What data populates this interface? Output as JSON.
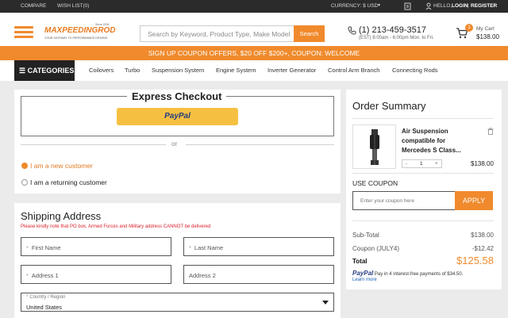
{
  "topbar": {
    "compare": "COMPARE",
    "wishlist": "WISH LIST(0)",
    "currency": "CURRENCY: $ USD",
    "hello": "HELLO,",
    "login": "LOGIN",
    "separator": "|",
    "register": "REGISTER"
  },
  "header": {
    "logo_text": "MAXPEEDINGRODS",
    "logo_since": "Since 2006",
    "logo_tagline": "YOUR GATEWAY TO PERFORMANCE DRIVING",
    "search_placeholder": "Search by Keyword, Product Type, Make Model Year",
    "search_button": "Search",
    "phone": "(1) 213-459-3517",
    "phone_hours": "(EST) 8:00am - 6:00pm Mon. to Fri.",
    "cart_count": "1",
    "cart_label": "My Cart",
    "cart_total": "$138.00"
  },
  "promo": "SIGN UP COUPON OFFERS, $20 OFF $200+, COUPON: WELCOME",
  "nav": {
    "categories": "CATEGORIES",
    "items": [
      "Coilovers",
      "Turbo",
      "Suspension System",
      "Engine System",
      "Inverter Generator",
      "Control Arm Branch",
      "Connecting Rods"
    ]
  },
  "checkout": {
    "express_title": "Express Checkout",
    "paypal_label": "PayPal",
    "or": "or",
    "new_customer": "I am a new customer",
    "returning_customer": "I am a returning customer"
  },
  "shipping": {
    "title": "Shipping Address",
    "note": "Please kindly note that PO box, Armed Forces and Military address CANNOT be delivered",
    "first_name": "First Name",
    "last_name": "Last Name",
    "address1": "Address 1",
    "address2": "Address 2",
    "country_label": "Country / Region",
    "country_value": "United States",
    "required_mark": "*"
  },
  "summary": {
    "title": "Order Summary",
    "product_name": "Air Suspension compatible for Mercedes S Class...",
    "qty_minus": "-",
    "qty_value": "1",
    "qty_plus": "+",
    "product_price": "$138.00",
    "use_coupon": "USE COUPON",
    "coupon_placeholder": "Enter your coupon here",
    "apply": "APPLY",
    "subtotal_label": "Sub-Total",
    "subtotal_value": "$138.00",
    "coupon_label": "Coupon (JULY4)",
    "coupon_value": "-$12.42",
    "total_label": "Total",
    "total_value": "$125.58",
    "paypal_word": "PayPal",
    "paylater_text": "Pay in 4 interest-free payments of $34.50.",
    "learn_more": "Learn more"
  },
  "colors": {
    "accent": "#f08a2c",
    "dark": "#2b2b2b",
    "warning": "#d9232e"
  }
}
